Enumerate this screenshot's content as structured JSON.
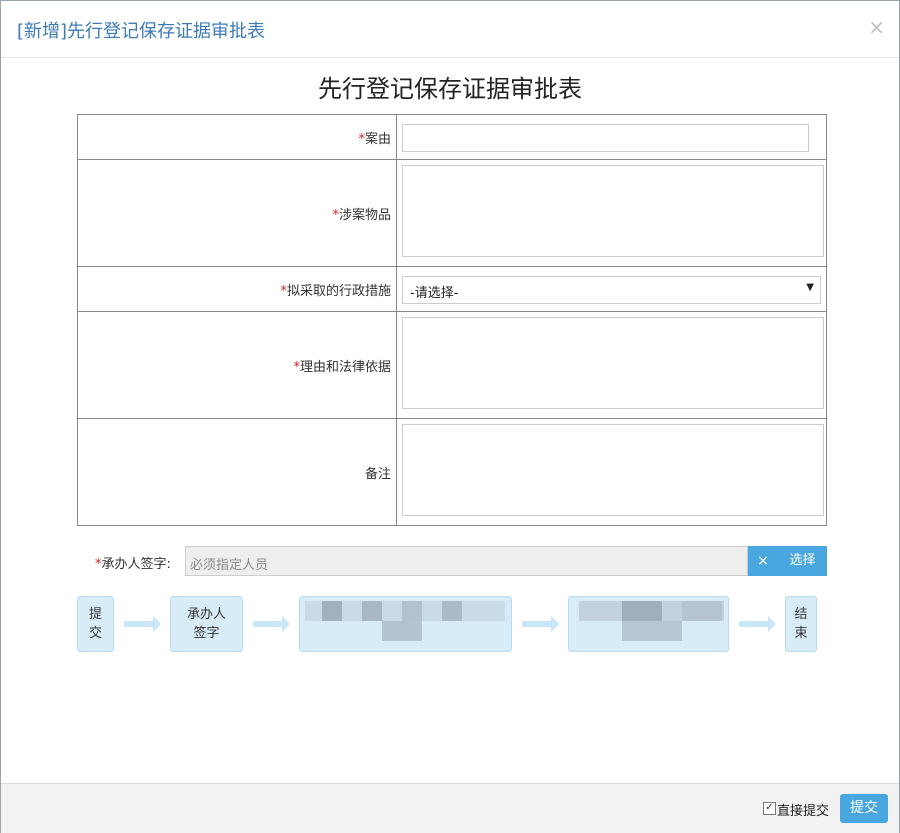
{
  "dialog": {
    "title": "[新增]先行登记保存证据审批表",
    "close": "×"
  },
  "form": {
    "title": "先行登记保存证据审批表",
    "required_mark": "*",
    "rows": [
      {
        "label": "案由",
        "required": true,
        "type": "input",
        "value": ""
      },
      {
        "label": "涉案物品",
        "required": true,
        "type": "textarea",
        "value": ""
      },
      {
        "label": "拟采取的行政措施",
        "required": true,
        "type": "select",
        "value": "-请选择-"
      },
      {
        "label": "理由和法律依据",
        "required": true,
        "type": "textarea",
        "value": ""
      },
      {
        "label": "备注",
        "required": false,
        "type": "textarea",
        "value": ""
      }
    ]
  },
  "signer": {
    "label": "承办人签字:",
    "placeholder": "必须指定人员",
    "clear": "×",
    "select": "选择"
  },
  "flow": {
    "nodes": [
      "提\n交",
      "承办人\n签字",
      "",
      "",
      "结\n束"
    ]
  },
  "footer": {
    "direct_submit_label": "直接提交",
    "direct_submit_checked": true,
    "submit": "提交"
  },
  "colors": {
    "title_blue": "#3d7ab8",
    "button_blue": "#4aa6de",
    "required_red": "#e02020",
    "flow_node_bg": "#d8ecf8"
  }
}
